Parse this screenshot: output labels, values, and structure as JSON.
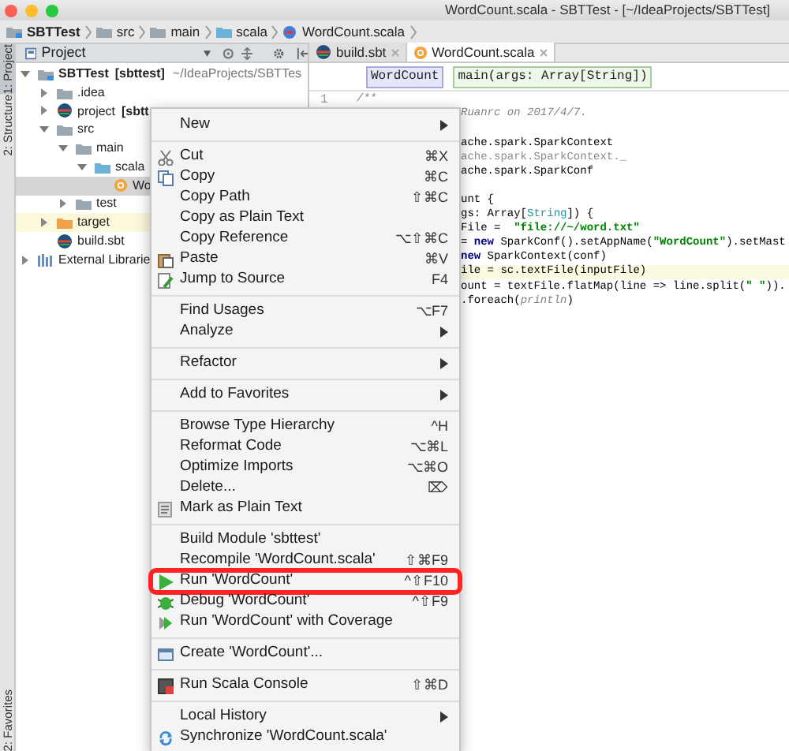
{
  "window": {
    "title": "WordCount.scala - SBTTest - [~/IdeaProjects/SBTTest]"
  },
  "breadcrumbs": [
    {
      "label": "SBTTest",
      "kind": "module"
    },
    {
      "label": "src",
      "kind": "folder"
    },
    {
      "label": "main",
      "kind": "folder"
    },
    {
      "label": "scala",
      "kind": "source"
    },
    {
      "label": "WordCount.scala",
      "kind": "file"
    }
  ],
  "tool_strip": [
    {
      "label": "1: Project",
      "selected": true
    },
    {
      "label": "2: Structure",
      "selected": false
    },
    {
      "label": "2: Favorites",
      "selected": false
    }
  ],
  "project_panel": {
    "title": "Project",
    "tree": [
      {
        "name": "SBTTest",
        "module": "[sbttest]",
        "path": "~/IdeaProjects/SBTTes",
        "kind": "module",
        "expanded": true,
        "selected": false,
        "highlighted": false,
        "children": [
          {
            "name": ".idea",
            "kind": "folder",
            "expanded": false,
            "selected": false,
            "highlighted": false
          },
          {
            "name": "project",
            "module": "[sbtt",
            "kind": "sbt",
            "expanded": false,
            "selected": false,
            "highlighted": false
          },
          {
            "name": "src",
            "kind": "folder",
            "expanded": true,
            "selected": false,
            "highlighted": false,
            "children": [
              {
                "name": "main",
                "kind": "folder",
                "expanded": true,
                "selected": false,
                "highlighted": false,
                "children": [
                  {
                    "name": "scala",
                    "kind": "source",
                    "expanded": true,
                    "selected": false,
                    "highlighted": false,
                    "children": [
                      {
                        "name": "Wo",
                        "kind": "scala",
                        "selected": true,
                        "highlighted": false
                      }
                    ]
                  }
                ]
              },
              {
                "name": "test",
                "kind": "folder",
                "expanded": false,
                "selected": false,
                "highlighted": false
              }
            ]
          },
          {
            "name": "target",
            "kind": "excluded",
            "expanded": false,
            "selected": false,
            "highlighted": true
          },
          {
            "name": "build.sbt",
            "kind": "sbt",
            "selected": false,
            "highlighted": false
          }
        ]
      },
      {
        "name": "External Librarie",
        "kind": "libraries",
        "expanded": false,
        "selected": false,
        "highlighted": false
      }
    ]
  },
  "editor": {
    "tabs": [
      {
        "label": "build.sbt",
        "kind": "sbt",
        "selected": false
      },
      {
        "label": "WordCount.scala",
        "kind": "scala",
        "selected": true
      }
    ],
    "crumbs": [
      {
        "label": "WordCount",
        "kind": "object"
      },
      {
        "label": "main(args: Array[String])",
        "kind": "method"
      }
    ],
    "lines": [
      {
        "line_number": "1",
        "highlighted": false,
        "segments": [
          {
            "kind": "comment",
            "text": "/**"
          }
        ]
      },
      {
        "highlighted": false,
        "segments": [
          {
            "kind": "comment",
            "text": "Ruanrc on 2017/4/7."
          }
        ]
      },
      {
        "highlighted": false,
        "segments": [
          {
            "kind": "plain",
            "text": "ache.spark.SparkContext"
          }
        ]
      },
      {
        "highlighted": false,
        "segments": [
          {
            "kind": "dim",
            "text": "ache.spark.SparkContext._"
          }
        ]
      },
      {
        "highlighted": false,
        "segments": [
          {
            "kind": "plain",
            "text": "ache.spark.SparkConf"
          }
        ]
      },
      {
        "highlighted": false,
        "segments": [
          {
            "kind": "plain",
            "text": "unt {"
          }
        ]
      },
      {
        "highlighted": false,
        "segments": [
          {
            "kind": "plain",
            "text": "gs: Array["
          },
          {
            "kind": "type",
            "text": "String"
          },
          {
            "kind": "plain",
            "text": "]) {"
          }
        ]
      },
      {
        "highlighted": false,
        "segments": [
          {
            "kind": "plain",
            "text": "File =  "
          },
          {
            "kind": "string",
            "text": "\"file://~/word.txt\""
          }
        ]
      },
      {
        "highlighted": false,
        "segments": [
          {
            "kind": "plain",
            "text": "= "
          },
          {
            "kind": "keyword",
            "text": "new"
          },
          {
            "kind": "plain",
            "text": " SparkConf().setAppName("
          },
          {
            "kind": "string",
            "text": "\"WordCount\""
          },
          {
            "kind": "plain",
            "text": ").setMast"
          }
        ]
      },
      {
        "highlighted": false,
        "segments": [
          {
            "kind": "keyword",
            "text": "new"
          },
          {
            "kind": "plain",
            "text": " SparkContext(conf)"
          }
        ]
      },
      {
        "highlighted": true,
        "segments": [
          {
            "kind": "plain",
            "text": "ile = sc.textFile(inputFile)"
          }
        ]
      },
      {
        "highlighted": false,
        "segments": [
          {
            "kind": "plain",
            "text": "ount = textFile.flatMap(line => line.split("
          },
          {
            "kind": "string",
            "text": "\" \""
          },
          {
            "kind": "plain",
            "text": "))."
          }
        ]
      },
      {
        "highlighted": false,
        "segments": [
          {
            "kind": "plain",
            "text": ".foreach("
          },
          {
            "kind": "comment",
            "text": "println"
          },
          {
            "kind": "plain",
            "text": ")"
          }
        ]
      }
    ]
  },
  "context_menu": [
    {
      "kind": "item",
      "label": "New",
      "has_submenu": true,
      "highlighted": false
    },
    {
      "kind": "separator"
    },
    {
      "kind": "item",
      "label": "Cut",
      "shortcut": "⌘X",
      "has_submenu": false,
      "highlighted": false
    },
    {
      "kind": "item",
      "label": "Copy",
      "shortcut": "⌘C",
      "has_submenu": false,
      "highlighted": false
    },
    {
      "kind": "item",
      "label": "Copy Path",
      "shortcut": "⇧⌘C",
      "has_submenu": false,
      "highlighted": false
    },
    {
      "kind": "item",
      "label": "Copy as Plain Text",
      "has_submenu": false,
      "highlighted": false
    },
    {
      "kind": "item",
      "label": "Copy Reference",
      "shortcut": "⌥⇧⌘C",
      "has_submenu": false,
      "highlighted": false
    },
    {
      "kind": "item",
      "label": "Paste",
      "shortcut": "⌘V",
      "has_submenu": false,
      "highlighted": false
    },
    {
      "kind": "item",
      "label": "Jump to Source",
      "shortcut": "F4",
      "has_submenu": false,
      "highlighted": false
    },
    {
      "kind": "separator"
    },
    {
      "kind": "item",
      "label": "Find Usages",
      "shortcut": "⌥F7",
      "has_submenu": false,
      "highlighted": false
    },
    {
      "kind": "item",
      "label": "Analyze",
      "has_submenu": true,
      "highlighted": false
    },
    {
      "kind": "separator"
    },
    {
      "kind": "item",
      "label": "Refactor",
      "has_submenu": true,
      "highlighted": false
    },
    {
      "kind": "separator"
    },
    {
      "kind": "item",
      "label": "Add to Favorites",
      "has_submenu": true,
      "highlighted": false
    },
    {
      "kind": "separator"
    },
    {
      "kind": "item",
      "label": "Browse Type Hierarchy",
      "shortcut": "^H",
      "has_submenu": false,
      "highlighted": false
    },
    {
      "kind": "item",
      "label": "Reformat Code",
      "shortcut": "⌥⌘L",
      "has_submenu": false,
      "highlighted": false
    },
    {
      "kind": "item",
      "label": "Optimize Imports",
      "shortcut": "⌥⌘O",
      "has_submenu": false,
      "highlighted": false
    },
    {
      "kind": "item",
      "label": "Delete...",
      "shortcut": "⌦",
      "has_submenu": false,
      "highlighted": false
    },
    {
      "kind": "item",
      "label": "Mark as Plain Text",
      "has_submenu": false,
      "highlighted": false
    },
    {
      "kind": "separator"
    },
    {
      "kind": "item",
      "label": "Build Module 'sbttest'",
      "has_submenu": false,
      "highlighted": false
    },
    {
      "kind": "item",
      "label": "Recompile 'WordCount.scala'",
      "shortcut": "⇧⌘F9",
      "has_submenu": false,
      "highlighted": false
    },
    {
      "kind": "item",
      "label": "Run 'WordCount'",
      "shortcut": "^⇧F10",
      "has_submenu": false,
      "highlighted": true
    },
    {
      "kind": "item",
      "label": "Debug 'WordCount'",
      "shortcut": "^⇧F9",
      "has_submenu": false,
      "highlighted": false
    },
    {
      "kind": "item",
      "label": "Run 'WordCount' with Coverage",
      "has_submenu": false,
      "highlighted": false
    },
    {
      "kind": "separator"
    },
    {
      "kind": "item",
      "label": "Create 'WordCount'...",
      "has_submenu": false,
      "highlighted": false
    },
    {
      "kind": "separator"
    },
    {
      "kind": "item",
      "label": "Run Scala Console",
      "shortcut": "⇧⌘D",
      "has_submenu": false,
      "highlighted": false
    },
    {
      "kind": "separator"
    },
    {
      "kind": "item",
      "label": "Local History",
      "has_submenu": true,
      "highlighted": false
    },
    {
      "kind": "item",
      "label": "Synchronize 'WordCount.scala'",
      "has_submenu": false,
      "highlighted": false
    }
  ]
}
